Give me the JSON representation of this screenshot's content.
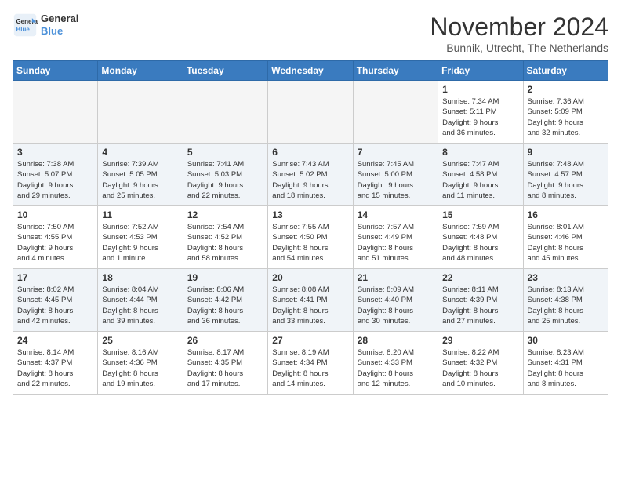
{
  "logo": {
    "line1": "General",
    "line2": "Blue"
  },
  "title": "November 2024",
  "location": "Bunnik, Utrecht, The Netherlands",
  "days_header": [
    "Sunday",
    "Monday",
    "Tuesday",
    "Wednesday",
    "Thursday",
    "Friday",
    "Saturday"
  ],
  "weeks": [
    [
      {
        "day": "",
        "info": ""
      },
      {
        "day": "",
        "info": ""
      },
      {
        "day": "",
        "info": ""
      },
      {
        "day": "",
        "info": ""
      },
      {
        "day": "",
        "info": ""
      },
      {
        "day": "1",
        "info": "Sunrise: 7:34 AM\nSunset: 5:11 PM\nDaylight: 9 hours\nand 36 minutes."
      },
      {
        "day": "2",
        "info": "Sunrise: 7:36 AM\nSunset: 5:09 PM\nDaylight: 9 hours\nand 32 minutes."
      }
    ],
    [
      {
        "day": "3",
        "info": "Sunrise: 7:38 AM\nSunset: 5:07 PM\nDaylight: 9 hours\nand 29 minutes."
      },
      {
        "day": "4",
        "info": "Sunrise: 7:39 AM\nSunset: 5:05 PM\nDaylight: 9 hours\nand 25 minutes."
      },
      {
        "day": "5",
        "info": "Sunrise: 7:41 AM\nSunset: 5:03 PM\nDaylight: 9 hours\nand 22 minutes."
      },
      {
        "day": "6",
        "info": "Sunrise: 7:43 AM\nSunset: 5:02 PM\nDaylight: 9 hours\nand 18 minutes."
      },
      {
        "day": "7",
        "info": "Sunrise: 7:45 AM\nSunset: 5:00 PM\nDaylight: 9 hours\nand 15 minutes."
      },
      {
        "day": "8",
        "info": "Sunrise: 7:47 AM\nSunset: 4:58 PM\nDaylight: 9 hours\nand 11 minutes."
      },
      {
        "day": "9",
        "info": "Sunrise: 7:48 AM\nSunset: 4:57 PM\nDaylight: 9 hours\nand 8 minutes."
      }
    ],
    [
      {
        "day": "10",
        "info": "Sunrise: 7:50 AM\nSunset: 4:55 PM\nDaylight: 9 hours\nand 4 minutes."
      },
      {
        "day": "11",
        "info": "Sunrise: 7:52 AM\nSunset: 4:53 PM\nDaylight: 9 hours\nand 1 minute."
      },
      {
        "day": "12",
        "info": "Sunrise: 7:54 AM\nSunset: 4:52 PM\nDaylight: 8 hours\nand 58 minutes."
      },
      {
        "day": "13",
        "info": "Sunrise: 7:55 AM\nSunset: 4:50 PM\nDaylight: 8 hours\nand 54 minutes."
      },
      {
        "day": "14",
        "info": "Sunrise: 7:57 AM\nSunset: 4:49 PM\nDaylight: 8 hours\nand 51 minutes."
      },
      {
        "day": "15",
        "info": "Sunrise: 7:59 AM\nSunset: 4:48 PM\nDaylight: 8 hours\nand 48 minutes."
      },
      {
        "day": "16",
        "info": "Sunrise: 8:01 AM\nSunset: 4:46 PM\nDaylight: 8 hours\nand 45 minutes."
      }
    ],
    [
      {
        "day": "17",
        "info": "Sunrise: 8:02 AM\nSunset: 4:45 PM\nDaylight: 8 hours\nand 42 minutes."
      },
      {
        "day": "18",
        "info": "Sunrise: 8:04 AM\nSunset: 4:44 PM\nDaylight: 8 hours\nand 39 minutes."
      },
      {
        "day": "19",
        "info": "Sunrise: 8:06 AM\nSunset: 4:42 PM\nDaylight: 8 hours\nand 36 minutes."
      },
      {
        "day": "20",
        "info": "Sunrise: 8:08 AM\nSunset: 4:41 PM\nDaylight: 8 hours\nand 33 minutes."
      },
      {
        "day": "21",
        "info": "Sunrise: 8:09 AM\nSunset: 4:40 PM\nDaylight: 8 hours\nand 30 minutes."
      },
      {
        "day": "22",
        "info": "Sunrise: 8:11 AM\nSunset: 4:39 PM\nDaylight: 8 hours\nand 27 minutes."
      },
      {
        "day": "23",
        "info": "Sunrise: 8:13 AM\nSunset: 4:38 PM\nDaylight: 8 hours\nand 25 minutes."
      }
    ],
    [
      {
        "day": "24",
        "info": "Sunrise: 8:14 AM\nSunset: 4:37 PM\nDaylight: 8 hours\nand 22 minutes."
      },
      {
        "day": "25",
        "info": "Sunrise: 8:16 AM\nSunset: 4:36 PM\nDaylight: 8 hours\nand 19 minutes."
      },
      {
        "day": "26",
        "info": "Sunrise: 8:17 AM\nSunset: 4:35 PM\nDaylight: 8 hours\nand 17 minutes."
      },
      {
        "day": "27",
        "info": "Sunrise: 8:19 AM\nSunset: 4:34 PM\nDaylight: 8 hours\nand 14 minutes."
      },
      {
        "day": "28",
        "info": "Sunrise: 8:20 AM\nSunset: 4:33 PM\nDaylight: 8 hours\nand 12 minutes."
      },
      {
        "day": "29",
        "info": "Sunrise: 8:22 AM\nSunset: 4:32 PM\nDaylight: 8 hours\nand 10 minutes."
      },
      {
        "day": "30",
        "info": "Sunrise: 8:23 AM\nSunset: 4:31 PM\nDaylight: 8 hours\nand 8 minutes."
      }
    ]
  ]
}
